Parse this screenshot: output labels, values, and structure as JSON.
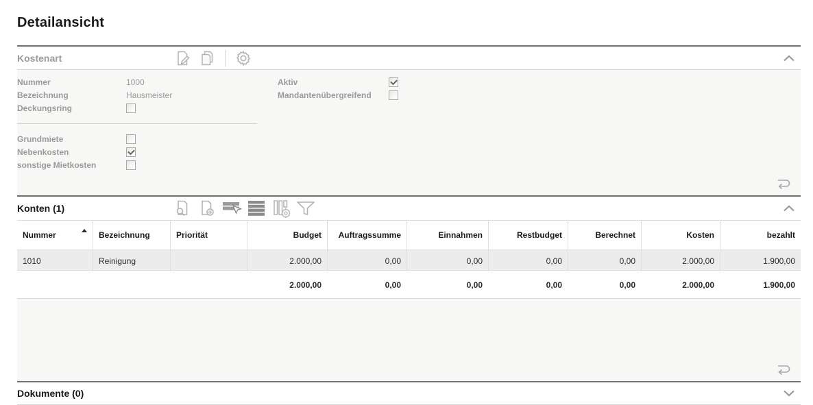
{
  "page": {
    "title": "Detailansicht"
  },
  "colors": {
    "accent_border": "#6f6f6f",
    "body_bg": "#f7f7f6",
    "row_bg": "#ececec",
    "gray_text": "#9b9b9b",
    "icon_gray": "#b3b3b3"
  },
  "kostenart": {
    "title": "Kostenart",
    "toolbar_icons": [
      "edit-icon",
      "copy-icon",
      "settings-icon"
    ],
    "collapse_icon": "chevron-up-icon",
    "fields_main": [
      {
        "label": "Nummer",
        "value": "1000",
        "type": "text"
      },
      {
        "label": "Bezeichnung",
        "value": "Hausmeister",
        "type": "text"
      },
      {
        "label": "Deckungsring",
        "checked": false,
        "type": "checkbox"
      }
    ],
    "fields_miete": [
      {
        "label": "Grundmiete",
        "checked": false,
        "type": "checkbox"
      },
      {
        "label": "Nebenkosten",
        "checked": true,
        "type": "checkbox"
      },
      {
        "label": "sonstige Mietkosten",
        "checked": false,
        "type": "checkbox"
      }
    ],
    "fields_right": [
      {
        "label": "Aktiv",
        "checked": true,
        "type": "checkbox"
      },
      {
        "label": "Mandantenübergreifend",
        "checked": false,
        "type": "checkbox"
      }
    ]
  },
  "konten": {
    "title": "Konten (1)",
    "toolbar_icons": [
      "view-document-icon",
      "add-document-icon",
      "select-rows-icon",
      "rows-icon",
      "column-settings-icon",
      "filter-icon"
    ],
    "collapse_icon": "chevron-up-icon",
    "sort": {
      "column": "Nummer",
      "direction": "ascending"
    },
    "columns": [
      "Nummer",
      "Bezeichnung",
      "Priorität",
      "Budget",
      "Auftragssumme",
      "Einnahmen",
      "Restbudget",
      "Berechnet",
      "Kosten",
      "bezahlt"
    ],
    "rows": [
      [
        "1010",
        "Reinigung",
        "",
        "2.000,00",
        "0,00",
        "0,00",
        "0,00",
        "0,00",
        "2.000,00",
        "1.900,00"
      ]
    ],
    "totals": [
      "",
      "",
      "",
      "2.000,00",
      "0,00",
      "0,00",
      "0,00",
      "0,00",
      "2.000,00",
      "1.900,00"
    ]
  },
  "dokumente": {
    "title": "Dokumente (0)",
    "collapse_icon": "chevron-down-icon"
  }
}
